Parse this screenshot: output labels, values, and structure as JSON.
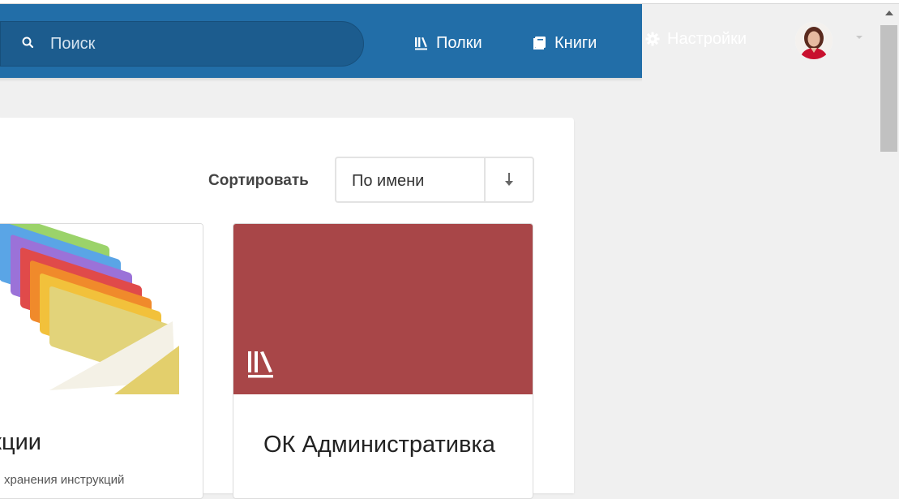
{
  "header": {
    "search": {
      "placeholder": "Поиск"
    },
    "nav": {
      "shelves": {
        "label": "Полки",
        "icon": "shelves-icon"
      },
      "books": {
        "label": "Книги",
        "icon": "book-icon"
      },
      "settings": {
        "label": "Настройки",
        "icon": "gear-icon"
      }
    },
    "user": {
      "avatar": "avatar",
      "menu_icon": "chevron-down-icon"
    }
  },
  "sort": {
    "label": "Сортировать",
    "value": "По имени",
    "direction_icon": "arrow-down-icon"
  },
  "shelves": [
    {
      "title": "рукции",
      "description": "хранения инструкций",
      "cover": "folders-image"
    },
    {
      "title": "ОК Административка",
      "description": "",
      "cover": "default-shelf-cover",
      "cover_color": "#a84648"
    }
  ],
  "colors": {
    "header_bg": "#226ea8",
    "search_bg": "#1c5c8e",
    "page_bg": "#f0f0f0"
  }
}
